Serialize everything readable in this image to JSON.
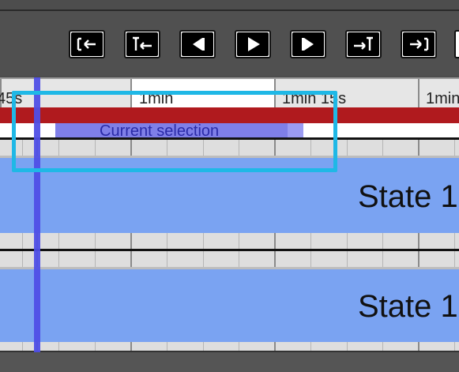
{
  "toolbar": {
    "buttons": [
      {
        "name": "jump-to-start-button",
        "icon": "jump-to-start-icon"
      },
      {
        "name": "jump-to-previous-marker-button",
        "icon": "previous-marker-icon"
      },
      {
        "name": "step-back-button",
        "icon": "step-back-icon"
      },
      {
        "name": "play-button",
        "icon": "play-icon"
      },
      {
        "name": "step-forward-button",
        "icon": "step-forward-icon"
      },
      {
        "name": "jump-to-next-marker-button",
        "icon": "next-marker-icon"
      },
      {
        "name": "jump-to-end-button",
        "icon": "jump-to-end-icon"
      }
    ]
  },
  "ruler": {
    "labels": [
      "45s",
      "1min",
      "1min 15s",
      "1min"
    ]
  },
  "selection": {
    "label": "Current selection"
  },
  "tracks": [
    {
      "label": "State 1"
    },
    {
      "label": "State 1"
    }
  ],
  "colors": {
    "selection_bar": "#b01a1e",
    "selection_band": "#7f7fe8",
    "track_fill": "#7aa3f2",
    "playhead": "#4f4fe6",
    "focus_outline": "#1fb8e6"
  }
}
